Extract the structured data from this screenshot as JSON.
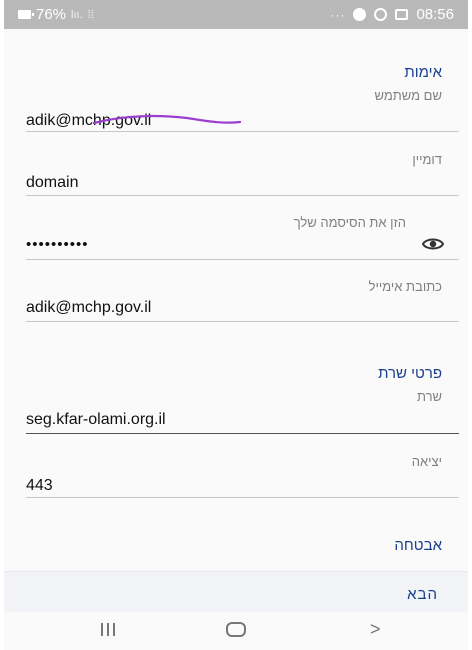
{
  "status_bar": {
    "battery": "76%",
    "signal": "lıı.",
    "extra": "⁞⁞",
    "dots": "···",
    "time": "08:56"
  },
  "account_section": {
    "title": "אימות",
    "username_label": "שם משתמש",
    "username_value": "adik@mchp.gov.il",
    "domain_label": "דומיין",
    "domain_value": "domain",
    "password_label": "הזן את הסיסמה שלך",
    "password_value": "••••••••••",
    "email_label": "כתובת אימייל",
    "email_value": "adik@mchp.gov.il"
  },
  "server_section": {
    "title": "פרטי שרת",
    "server_label": "שרת",
    "server_value": "seg.kfar-olami.org.il",
    "port_label": "יציאה",
    "port_value": "443",
    "security_label": "אבטחה"
  },
  "footer": {
    "next_label": "הבא"
  },
  "icons": {
    "password_toggle": "eye-icon",
    "nav_recent": "recent-apps-icon",
    "nav_home": "home-icon",
    "nav_back": "back-icon"
  },
  "colors": {
    "accent": "#1a3f8c",
    "status_bar": "#b9b9b9",
    "scribble": "#9a3fcf"
  }
}
